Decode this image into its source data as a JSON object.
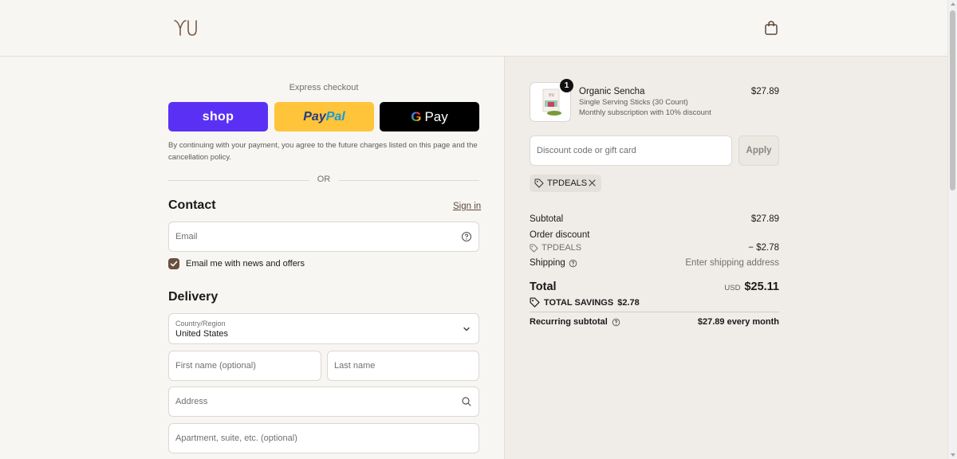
{
  "brand": {
    "logo_text": "YU"
  },
  "express": {
    "label": "Express checkout",
    "shop_label": "shop",
    "paypal_pay": "Pay",
    "paypal_pal": "Pal",
    "gpay_g": "G",
    "gpay_label": "Pay",
    "terms": "By continuing with your payment, you agree to the future charges listed on this page and the cancellation policy.",
    "or_label": "OR"
  },
  "contact": {
    "title": "Contact",
    "sign_in": "Sign in",
    "email_placeholder": "Email",
    "newsletter_label": "Email me with news and offers",
    "newsletter_checked": true
  },
  "delivery": {
    "title": "Delivery",
    "country_label": "Country/Region",
    "country_value": "United States",
    "first_name_placeholder": "First name (optional)",
    "last_name_placeholder": "Last name",
    "address_placeholder": "Address",
    "apartment_placeholder": "Apartment, suite, etc. (optional)"
  },
  "cart": {
    "item": {
      "name": "Organic Sencha",
      "variant": "Single Serving Sticks (30 Count)",
      "plan": "Monthly subscription with 10% discount",
      "price": "$27.89",
      "quantity": "1"
    },
    "discount_placeholder": "Discount code or gift card",
    "apply_label": "Apply",
    "applied_code": "TPDEALS"
  },
  "summary": {
    "subtotal_label": "Subtotal",
    "subtotal_value": "$27.89",
    "order_discount_label": "Order discount",
    "discount_code": "TPDEALS",
    "discount_value": "− $2.78",
    "shipping_label": "Shipping",
    "shipping_value": "Enter shipping address",
    "total_label": "Total",
    "currency": "USD",
    "total_value": "$25.11",
    "savings_label": "TOTAL SAVINGS",
    "savings_value": "$2.78",
    "recurring_label": "Recurring subtotal",
    "recurring_value": "$27.89 every month"
  },
  "colors": {
    "shop_purple": "#5a31f4",
    "paypal_yellow": "#ffc439",
    "checkbox_brown": "#6b4f3f",
    "page_bg": "#f8f6f3",
    "summary_bg": "#f0ede8"
  }
}
